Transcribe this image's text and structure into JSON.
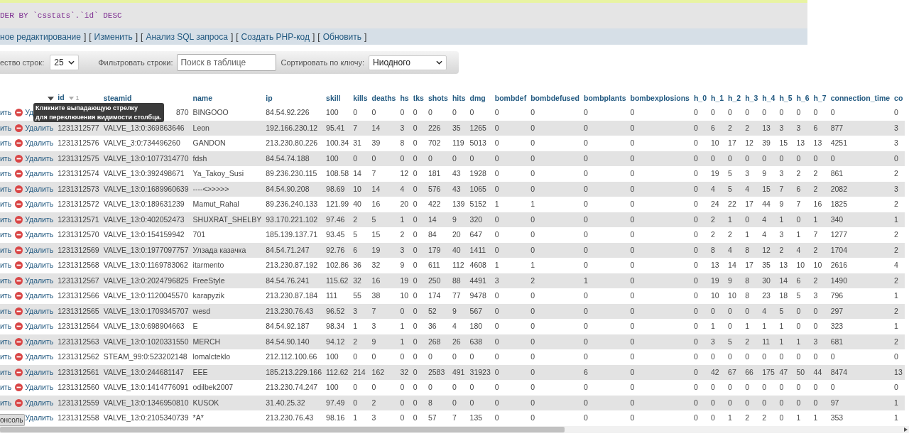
{
  "sql_panel": {
    "query": "DER BY `csstats`.`id` DESC"
  },
  "link_bar": {
    "open_bracket": "[",
    "close_bracket": "]",
    "links": [
      "ное редактирование",
      "Изменить",
      "Анализ SQL запроса",
      "Создать PHP-код",
      "Обновить"
    ]
  },
  "nav_bar": {
    "rows_label": "ество строк:",
    "rows_value": "25",
    "filter_label": "Фильтровать строки:",
    "filter_placeholder": "Поиск в таблице",
    "sort_label": "Сортировать по ключу:",
    "sort_value": "Ниодного"
  },
  "table": {
    "columns": [
      {
        "label": "id",
        "sort_order": "1"
      },
      {
        "label": "steamid"
      },
      {
        "label": "name"
      },
      {
        "label": "ip"
      },
      {
        "label": "skill"
      },
      {
        "label": "kills"
      },
      {
        "label": "deaths"
      },
      {
        "label": "hs"
      },
      {
        "label": "tks"
      },
      {
        "label": "shots"
      },
      {
        "label": "hits"
      },
      {
        "label": "dmg"
      },
      {
        "label": "bombdef"
      },
      {
        "label": "bombdefused"
      },
      {
        "label": "bombplants"
      },
      {
        "label": "bombexplosions"
      },
      {
        "label": "h_0"
      },
      {
        "label": "h_1"
      },
      {
        "label": "h_2"
      },
      {
        "label": "h_3"
      },
      {
        "label": "h_4"
      },
      {
        "label": "h_5"
      },
      {
        "label": "h_6"
      },
      {
        "label": "h_7"
      },
      {
        "label": "connection_time"
      },
      {
        "label": "co"
      }
    ],
    "rows": [
      {
        "edit": "ить",
        "delete": "Уд",
        "delete_icon": true,
        "steamid": "870",
        "steamid_partial": true,
        "name": "BINGOOO",
        "ip": "84.54.92.226",
        "values": [
          "100",
          "0",
          "0",
          "0",
          "0",
          "0",
          "0",
          "0",
          "0",
          "0",
          "0",
          "0",
          "0",
          "0",
          "0",
          "0",
          "0",
          "0",
          "0",
          "0",
          "0",
          "0"
        ]
      },
      {
        "edit": "ить",
        "delete": "Удалить",
        "delete_icon": true,
        "id": "1231312577",
        "steamid": "VALVE_13:0:369863646",
        "name": "Leon",
        "ip": "192.166.230.12",
        "values": [
          "95.41",
          "7",
          "14",
          "3",
          "0",
          "226",
          "35",
          "1265",
          "0",
          "0",
          "0",
          "0",
          "0",
          "6",
          "2",
          "2",
          "13",
          "3",
          "3",
          "6",
          "877",
          "3"
        ]
      },
      {
        "edit": "ить",
        "delete": "Удалить",
        "delete_icon": true,
        "id": "1231312576",
        "steamid": "VALVE_3:0:734496260",
        "name": "GANDON",
        "ip": "213.230.80.226",
        "values": [
          "100.34",
          "31",
          "39",
          "8",
          "0",
          "702",
          "119",
          "5013",
          "0",
          "0",
          "0",
          "0",
          "0",
          "10",
          "17",
          "12",
          "39",
          "15",
          "13",
          "13",
          "4251",
          "3"
        ]
      },
      {
        "edit": "ить",
        "delete": "Удалить",
        "delete_icon": true,
        "id": "1231312575",
        "steamid": "VALVE_13:0:1077314770",
        "name": "fdsh",
        "ip": "84.54.74.188",
        "values": [
          "100",
          "0",
          "0",
          "0",
          "0",
          "0",
          "0",
          "0",
          "0",
          "0",
          "0",
          "0",
          "0",
          "0",
          "0",
          "0",
          "0",
          "0",
          "0",
          "0",
          "0",
          "0"
        ]
      },
      {
        "edit": "ить",
        "delete": "Удалить",
        "delete_icon": true,
        "id": "1231312574",
        "steamid": "VALVE_13:0:392498671",
        "name": "Ya_Takoy_Susi",
        "ip": "89.236.230.115",
        "values": [
          "108.58",
          "14",
          "7",
          "12",
          "0",
          "181",
          "43",
          "1928",
          "0",
          "0",
          "0",
          "0",
          "0",
          "19",
          "5",
          "3",
          "9",
          "3",
          "2",
          "2",
          "861",
          "2"
        ]
      },
      {
        "edit": "ить",
        "delete": "Удалить",
        "delete_icon": true,
        "id": "1231312573",
        "steamid": "VALVE_13:0:1689960639",
        "name": "----<>>>>>",
        "ip": "84.54.90.208",
        "values": [
          "98.69",
          "10",
          "14",
          "4",
          "0",
          "576",
          "43",
          "1065",
          "0",
          "0",
          "0",
          "0",
          "0",
          "4",
          "5",
          "4",
          "15",
          "7",
          "6",
          "2",
          "2082",
          "3"
        ]
      },
      {
        "edit": "ить",
        "delete": "Удалить",
        "delete_icon": true,
        "id": "1231312572",
        "steamid": "VALVE_13:0:189631239",
        "name": "Mamut_Rahal",
        "ip": "89.236.240.133",
        "values": [
          "121.99",
          "40",
          "16",
          "20",
          "0",
          "422",
          "139",
          "5152",
          "1",
          "1",
          "0",
          "0",
          "0",
          "24",
          "22",
          "17",
          "44",
          "9",
          "7",
          "16",
          "1825",
          "2"
        ]
      },
      {
        "edit": "ить",
        "delete": "Удалить",
        "delete_icon": true,
        "id": "1231312571",
        "steamid": "VALVE_13:0:402052473",
        "name": "SHUXRAT_SHELBY",
        "ip": "93.170.221.102",
        "values": [
          "97.46",
          "2",
          "5",
          "1",
          "0",
          "14",
          "9",
          "320",
          "0",
          "0",
          "0",
          "0",
          "0",
          "2",
          "1",
          "0",
          "4",
          "1",
          "0",
          "1",
          "340",
          "1"
        ]
      },
      {
        "edit": "ить",
        "delete": "Удалить",
        "delete_icon": true,
        "id": "1231312570",
        "steamid": "VALVE_13:0:154159942",
        "name": "701",
        "ip": "185.139.137.71",
        "values": [
          "93.45",
          "5",
          "15",
          "2",
          "0",
          "84",
          "20",
          "647",
          "0",
          "0",
          "0",
          "0",
          "0",
          "2",
          "2",
          "1",
          "4",
          "3",
          "1",
          "7",
          "1277",
          "2"
        ]
      },
      {
        "edit": "ить",
        "delete": "Удалить",
        "delete_icon": true,
        "id": "1231312569",
        "steamid": "VALVE_13:0:1977097757",
        "name": "Улзада казачка",
        "ip": "84.54.71.247",
        "values": [
          "92.76",
          "6",
          "19",
          "3",
          "0",
          "179",
          "40",
          "1411",
          "0",
          "0",
          "0",
          "0",
          "0",
          "8",
          "4",
          "8",
          "12",
          "2",
          "4",
          "2",
          "1704",
          "2"
        ]
      },
      {
        "edit": "ить",
        "delete": "Удалить",
        "delete_icon": true,
        "id": "1231312568",
        "steamid": "VALVE_13:0:1169783062",
        "name": "itarmento",
        "ip": "213.230.87.192",
        "values": [
          "102.86",
          "36",
          "32",
          "9",
          "0",
          "611",
          "112",
          "4608",
          "1",
          "1",
          "0",
          "0",
          "0",
          "13",
          "14",
          "17",
          "35",
          "13",
          "10",
          "10",
          "2616",
          "4"
        ]
      },
      {
        "edit": "ить",
        "delete": "Удалить",
        "delete_icon": true,
        "id": "1231312567",
        "steamid": "VALVE_13:0:2024796825",
        "name": "FreeStyle",
        "ip": "84.54.76.241",
        "values": [
          "115.62",
          "32",
          "16",
          "19",
          "0",
          "250",
          "88",
          "4491",
          "3",
          "2",
          "1",
          "0",
          "0",
          "19",
          "9",
          "8",
          "30",
          "14",
          "6",
          "2",
          "1490",
          "2"
        ]
      },
      {
        "edit": "ить",
        "delete": "Удалить",
        "delete_icon": true,
        "id": "1231312566",
        "steamid": "VALVE_13:0:1120045570",
        "name": "karapyzik",
        "ip": "213.230.87.184",
        "values": [
          "111",
          "55",
          "38",
          "10",
          "0",
          "174",
          "77",
          "9478",
          "0",
          "0",
          "0",
          "0",
          "0",
          "10",
          "10",
          "8",
          "23",
          "18",
          "5",
          "3",
          "796",
          "1"
        ]
      },
      {
        "edit": "ить",
        "delete": "Удалить",
        "delete_icon": true,
        "id": "1231312565",
        "steamid": "VALVE_13:0:1709345707",
        "name": "wesd",
        "ip": "213.230.76.43",
        "values": [
          "96.52",
          "3",
          "7",
          "0",
          "0",
          "52",
          "9",
          "567",
          "0",
          "0",
          "0",
          "0",
          "0",
          "0",
          "0",
          "0",
          "4",
          "5",
          "0",
          "0",
          "297",
          "2"
        ]
      },
      {
        "edit": "ить",
        "delete": "Удалить",
        "delete_icon": true,
        "id": "1231312564",
        "steamid": "VALVE_13:0:698904663",
        "name": "E",
        "ip": "84.54.92.187",
        "values": [
          "98.34",
          "1",
          "3",
          "1",
          "0",
          "36",
          "4",
          "180",
          "0",
          "0",
          "0",
          "0",
          "0",
          "1",
          "0",
          "1",
          "1",
          "1",
          "0",
          "0",
          "323",
          "1"
        ]
      },
      {
        "edit": "ить",
        "delete": "Удалить",
        "delete_icon": true,
        "id": "1231312563",
        "steamid": "VALVE_13:0:1020331550",
        "name": "MERCH",
        "ip": "84.54.90.140",
        "values": [
          "94.12",
          "2",
          "9",
          "1",
          "0",
          "268",
          "26",
          "638",
          "0",
          "0",
          "0",
          "0",
          "0",
          "3",
          "5",
          "2",
          "11",
          "1",
          "1",
          "3",
          "681",
          "2"
        ]
      },
      {
        "edit": "ить",
        "delete": "Удалить",
        "delete_icon": true,
        "id": "1231312562",
        "steamid": "STEAM_99:0:523202148",
        "name": "lomalcteklo",
        "ip": "212.112.100.66",
        "values": [
          "100",
          "0",
          "0",
          "0",
          "0",
          "0",
          "0",
          "0",
          "0",
          "0",
          "0",
          "0",
          "0",
          "0",
          "0",
          "0",
          "0",
          "0",
          "0",
          "0",
          "0",
          "0"
        ]
      },
      {
        "edit": "ить",
        "delete": "Удалить",
        "delete_icon": true,
        "id": "1231312561",
        "steamid": "VALVE_13:0:244681147",
        "name": "EEE",
        "ip": "185.213.229.166",
        "values": [
          "112.62",
          "214",
          "162",
          "32",
          "0",
          "2583",
          "491",
          "31923",
          "0",
          "0",
          "6",
          "0",
          "0",
          "42",
          "67",
          "66",
          "175",
          "47",
          "50",
          "44",
          "8474",
          "13"
        ]
      },
      {
        "edit": "ить",
        "delete": "Удалить",
        "delete_icon": true,
        "id": "1231312560",
        "steamid": "VALVE_13:0:1414776091",
        "name": "odilbek2007",
        "ip": "213.230.74.247",
        "values": [
          "100",
          "0",
          "0",
          "0",
          "0",
          "0",
          "0",
          "0",
          "0",
          "0",
          "0",
          "0",
          "0",
          "0",
          "0",
          "0",
          "0",
          "0",
          "0",
          "0",
          "0",
          "0"
        ]
      },
      {
        "edit": "ить",
        "delete": "Удалить",
        "delete_icon": true,
        "id": "1231312559",
        "steamid": "VALVE_13:0:1346950810",
        "name": "KUSOK",
        "ip": "31.40.25.32",
        "values": [
          "97.49",
          "0",
          "2",
          "0",
          "0",
          "8",
          "0",
          "0",
          "0",
          "0",
          "0",
          "0",
          "0",
          "0",
          "0",
          "0",
          "0",
          "0",
          "0",
          "0",
          "97",
          "1"
        ]
      },
      {
        "delete": "Удалить",
        "delete_icon": false,
        "id": "1231312558",
        "steamid": "VALVE_13:0:2105340739",
        "name": "*A*",
        "ip": "213.230.76.43",
        "values": [
          "98.16",
          "1",
          "3",
          "0",
          "0",
          "57",
          "7",
          "135",
          "0",
          "0",
          "0",
          "0",
          "0",
          "0",
          "1",
          "2",
          "2",
          "0",
          "1",
          "1",
          "353",
          "1"
        ]
      }
    ]
  },
  "tooltip": {
    "lines": [
      "Кликните выпадающую стрелку",
      "для переключения видимости столбца."
    ]
  },
  "console_button": {
    "label": "онсоль"
  }
}
